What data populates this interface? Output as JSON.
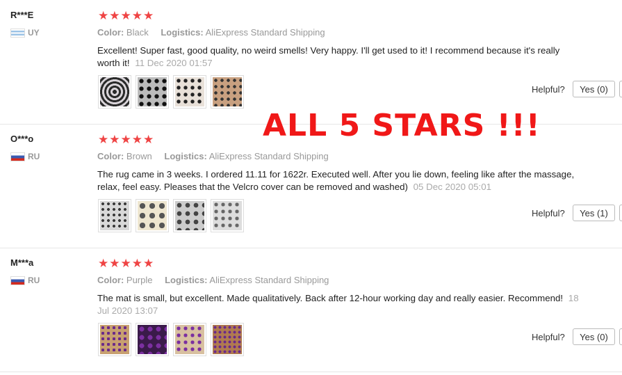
{
  "overlay_text": "ALL 5 STARS !!!",
  "helpful_label": "Helpful?",
  "reviews": [
    {
      "user": "R***E",
      "country": "UY",
      "flag": "uy",
      "stars": "★★★★★",
      "color_label": "Color:",
      "color": "Black",
      "logistics_label": "Logistics:",
      "logistics": "AliExpress Standard Shipping",
      "text": "Excellent! Super fast, good quality, no weird smells! Very happy. I'll get used to it! I recommend because it's really worth it!",
      "date": "11 Dec 2020 01:57",
      "yes": "Yes (0)"
    },
    {
      "user": "O***o",
      "country": "RU",
      "flag": "ru",
      "stars": "★★★★★",
      "color_label": "Color:",
      "color": "Brown",
      "logistics_label": "Logistics:",
      "logistics": "AliExpress Standard Shipping",
      "text": "The rug came in 3 weeks. I ordered 11.11 for 1622r. Executed well. After you lie down, feeling like after the massage, relax, feel easy. Pleases that the Velcro cover can be removed and washed)",
      "date": "05 Dec 2020 05:01",
      "yes": "Yes (1)"
    },
    {
      "user": "M***a",
      "country": "RU",
      "flag": "ru",
      "stars": "★★★★★",
      "color_label": "Color:",
      "color": "Purple",
      "logistics_label": "Logistics:",
      "logistics": "AliExpress Standard Shipping",
      "text": "The mat is small, but excellent. Made qualitatively. Back after 12-hour working day and really easier. Recommend!",
      "date": "18 Jul 2020 13:07",
      "yes": "Yes (0)"
    }
  ]
}
